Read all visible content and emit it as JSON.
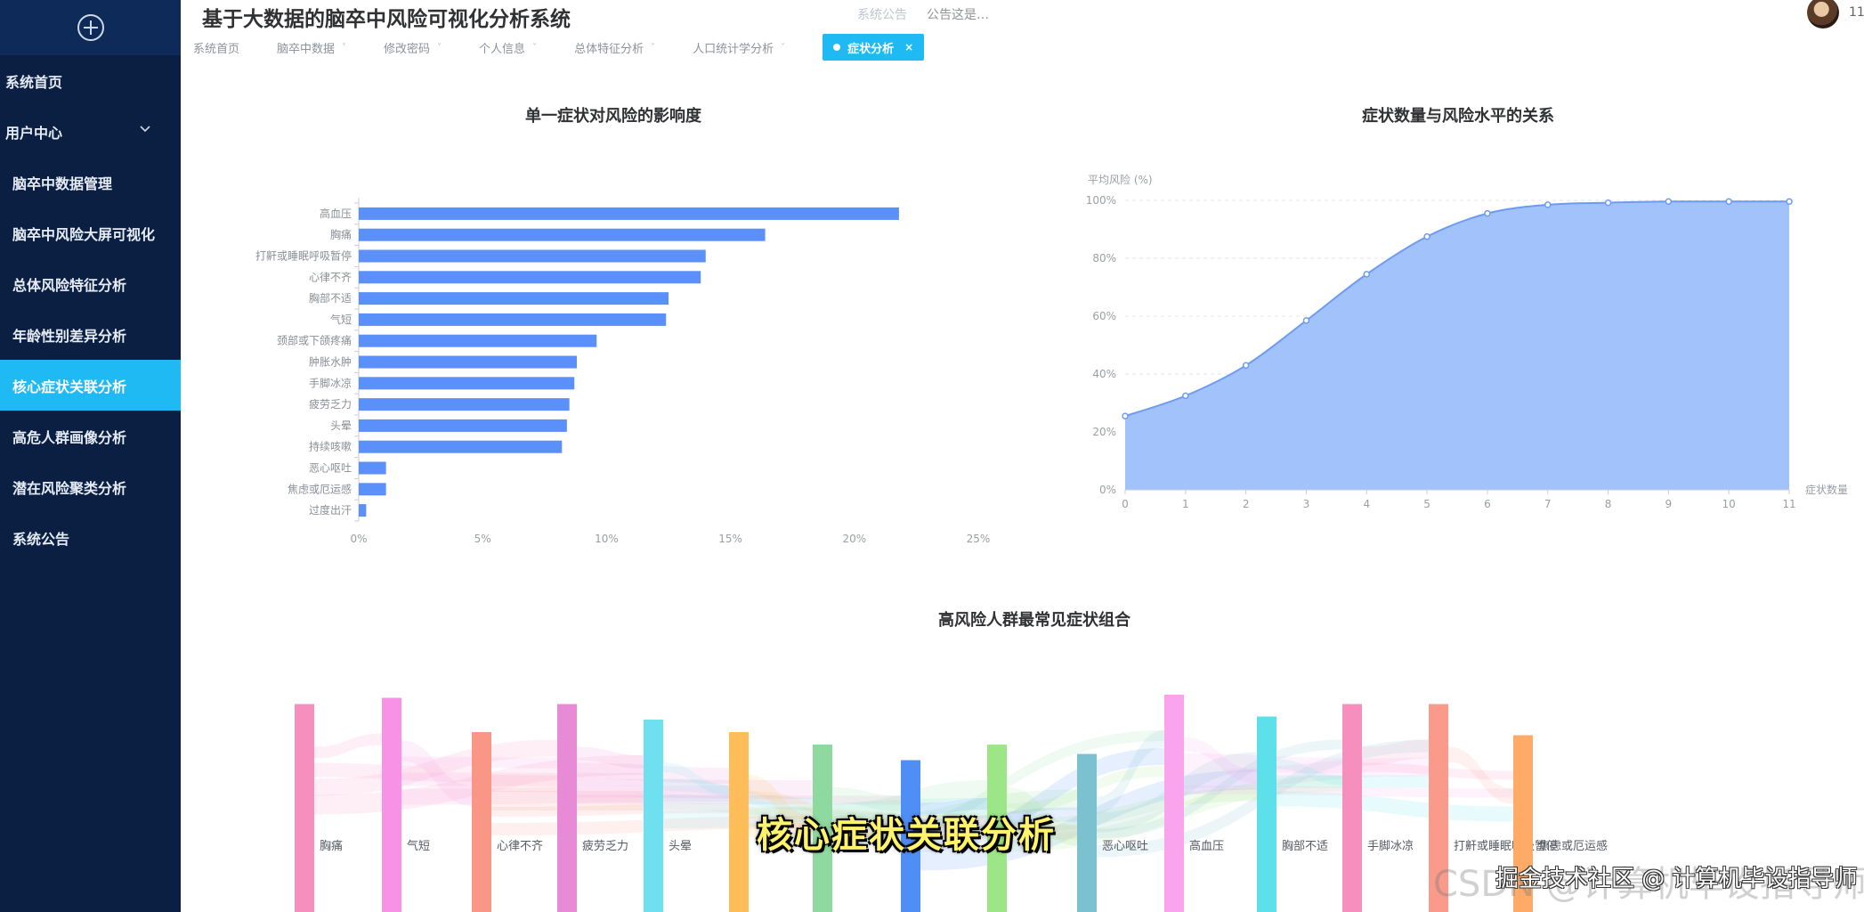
{
  "sidebar": {
    "items": [
      {
        "label": "系统首页",
        "top": true
      },
      {
        "label": "用户中心",
        "top": true,
        "expandable": true
      },
      {
        "label": "脑卒中数据管理"
      },
      {
        "label": "脑卒中风险大屏可视化"
      },
      {
        "label": "总体风险特征分析"
      },
      {
        "label": "年龄性别差异分析"
      },
      {
        "label": "核心症状关联分析",
        "active": true
      },
      {
        "label": "高危人群画像分析"
      },
      {
        "label": "潜在风险聚类分析"
      },
      {
        "label": "系统公告"
      }
    ]
  },
  "header": {
    "title": "基于大数据的脑卒中风险可视化分析系统",
    "notice_label": "系统公告",
    "notice_text": "公告这是…",
    "user_name": "11"
  },
  "tabs": [
    {
      "label": "系统首页"
    },
    {
      "label": "脑卒中数据",
      "caret": true
    },
    {
      "label": "修改密码",
      "caret": true
    },
    {
      "label": "个人信息",
      "caret": true
    },
    {
      "label": "总体特征分析",
      "caret": true
    },
    {
      "label": "人口统计学分析",
      "caret": true
    },
    {
      "label": "症状分析",
      "active": true
    }
  ],
  "colors": {
    "accent": "#1fbaf3",
    "sidebar_bg": "#0b1f42",
    "bar": "#5b8ff9",
    "area_fill": "#9dbffb",
    "area_line": "#6d9bf2"
  },
  "chart_data": [
    {
      "type": "bar",
      "orientation": "horizontal",
      "title": "单一症状对风险的影响度",
      "categories": [
        "高血压",
        "胸痛",
        "打鼾或睡眠呼吸暂停",
        "心律不齐",
        "胸部不适",
        "气短",
        "颈部或下颌疼痛",
        "肿胀水肿",
        "手脚冰凉",
        "疲劳乏力",
        "头晕",
        "持续咳嗽",
        "恶心呕吐",
        "焦虑或厄运感",
        "过度出汗"
      ],
      "values": [
        21.8,
        16.4,
        14.0,
        13.8,
        12.5,
        12.4,
        9.6,
        8.8,
        8.7,
        8.5,
        8.4,
        8.2,
        1.1,
        1.1,
        0.3
      ],
      "xlim": [
        0,
        25
      ],
      "xticks": [
        "0%",
        "5%",
        "10%",
        "15%",
        "20%",
        "25%"
      ]
    },
    {
      "type": "area",
      "title": "症状数量与风险水平的关系",
      "ylabel": "平均风险 (%)",
      "xlabel": "症状数量",
      "x": [
        0,
        1,
        2,
        3,
        4,
        5,
        6,
        7,
        8,
        9,
        10,
        11
      ],
      "values": [
        25.5,
        32.5,
        43.0,
        58.5,
        74.5,
        87.5,
        95.5,
        98.5,
        99.2,
        99.6,
        99.6,
        99.6
      ],
      "ylim": [
        0,
        100
      ],
      "yticks": [
        "0%",
        "20%",
        "40%",
        "60%",
        "80%",
        "100%"
      ]
    },
    {
      "type": "sankey",
      "title": "高风险人群最常见症状组合",
      "nodes": [
        {
          "name": "胸痛",
          "color": "#f78fbe",
          "level": 0.28
        },
        {
          "name": "气短",
          "color": "#f792e6",
          "level": 0.3
        },
        {
          "name": "心律不齐",
          "color": "#f99685",
          "level": 0.19
        },
        {
          "name": "疲劳乏力",
          "color": "#e78bd6",
          "level": 0.28
        },
        {
          "name": "头晕",
          "color": "#6ee0ef",
          "level": 0.23
        },
        {
          "name": "",
          "color": "#ffbd59",
          "level": 0.19
        },
        {
          "name": "",
          "color": "#8ed9a0",
          "level": 0.15
        },
        {
          "name": "",
          "color": "#4f8ef5",
          "level": 0.1
        },
        {
          "name": "",
          "color": "#9ce687",
          "level": 0.15
        },
        {
          "name": "恶心呕吐",
          "color": "#7bc1cf",
          "level": 0.12
        },
        {
          "name": "高血压",
          "color": "#f9a4ec",
          "level": 0.31
        },
        {
          "name": "胸部不适",
          "color": "#5ee0ea",
          "level": 0.24
        },
        {
          "name": "手脚冰凉",
          "color": "#f78fbe",
          "level": 0.28
        },
        {
          "name": "打鼾或睡眠呼吸暂停",
          "color": "#f99a8b",
          "level": 0.28
        },
        {
          "name": "焦虑或厄运感",
          "color": "#ffaa66",
          "level": 0.18
        }
      ]
    }
  ],
  "overlay": {
    "caption": "核心症状关联分析",
    "watermark_faint": "CSDN @计算机毕设指导师",
    "watermark": "掘金技术社区 @ 计算机毕设指导师"
  }
}
